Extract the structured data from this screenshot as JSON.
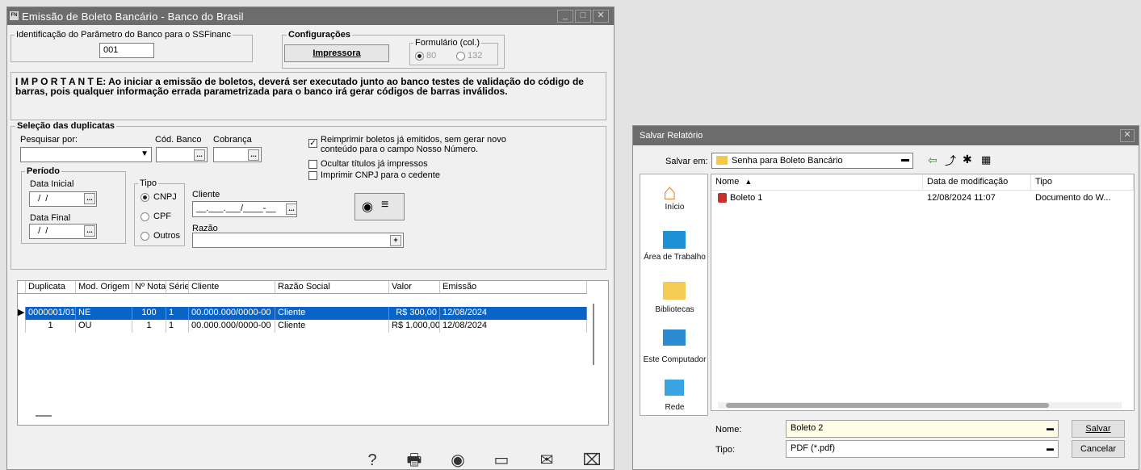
{
  "main_window": {
    "title": "Emissão de Boleto Bancário - Banco do Brasil",
    "app_icon_text": "FN",
    "param_group": {
      "legend": "Identificação do Parâmetro do Banco para o SSFinanc",
      "value": "001"
    },
    "config_group": {
      "legend": "Configurações",
      "printer_button": "Impressora"
    },
    "form_group": {
      "legend": "Formulário (col.)",
      "opt80": "80",
      "opt132": "132"
    },
    "important_text": "I M P O R T A N T E: Ao iniciar a emissão de boletos, deverá ser executado junto ao banco testes de validação do código de barras, pois qualquer informação errada parametrizada para o banco irá gerar códigos de barras inválidos.",
    "selection": {
      "legend": "Seleção das duplicatas",
      "search_label": "Pesquisar por:",
      "bank_code_label": "Cód. Banco",
      "billing_label": "Cobrança",
      "reprint_label_1": "Reimprimir boletos já emitidos, sem gerar novo",
      "reprint_label_2": "conteúdo para o campo Nosso Número.",
      "hide_label": "Ocultar títulos já impressos",
      "cnpj_label": "Imprimir CNPJ para o cedente",
      "period_legend": "Período",
      "start_label": "Data Inicial",
      "end_label": "Data Final",
      "date_mask": "  /  /",
      "type_legend": "Tipo",
      "type_cnpj": "CNPJ",
      "type_cpf": "CPF",
      "type_outros": "Outros",
      "client_label": "Cliente",
      "client_mask": "__.___.___/____-__",
      "razao_label": "Razão"
    },
    "grid": {
      "headers": [
        "Duplicata",
        "Mod. Origem",
        "Nº Nota",
        "Série",
        "Cliente",
        "Razão Social",
        "Valor",
        "Emissão"
      ],
      "rows": [
        [
          "0000001/01",
          "NE",
          "100",
          "1",
          "00.000.000/0000-00",
          "Cliente",
          "R$ 300,00",
          "12/08/2024"
        ],
        [
          "1",
          "OU",
          "1",
          "1",
          "00.000.000/0000-00",
          "Cliente",
          "R$ 1.000,00",
          "12/08/2024"
        ]
      ]
    }
  },
  "save_dialog": {
    "title": "Salvar Relatório",
    "save_in_label": "Salvar em:",
    "folder": "Senha para Boleto Bancário",
    "places": [
      "Início",
      "Área de Trabalho",
      "Bibliotecas",
      "Este Computador",
      "Rede"
    ],
    "columns": [
      "Nome",
      "Data de modificação",
      "Tipo"
    ],
    "files": [
      {
        "name": "Boleto 1",
        "modified": "12/08/2024 11:07",
        "type": "Documento do W..."
      }
    ],
    "name_label": "Nome:",
    "name_value": "Boleto 2",
    "type_label": "Tipo:",
    "type_value": "PDF (*.pdf)",
    "save_button": "Salvar",
    "cancel_button": "Cancelar"
  }
}
